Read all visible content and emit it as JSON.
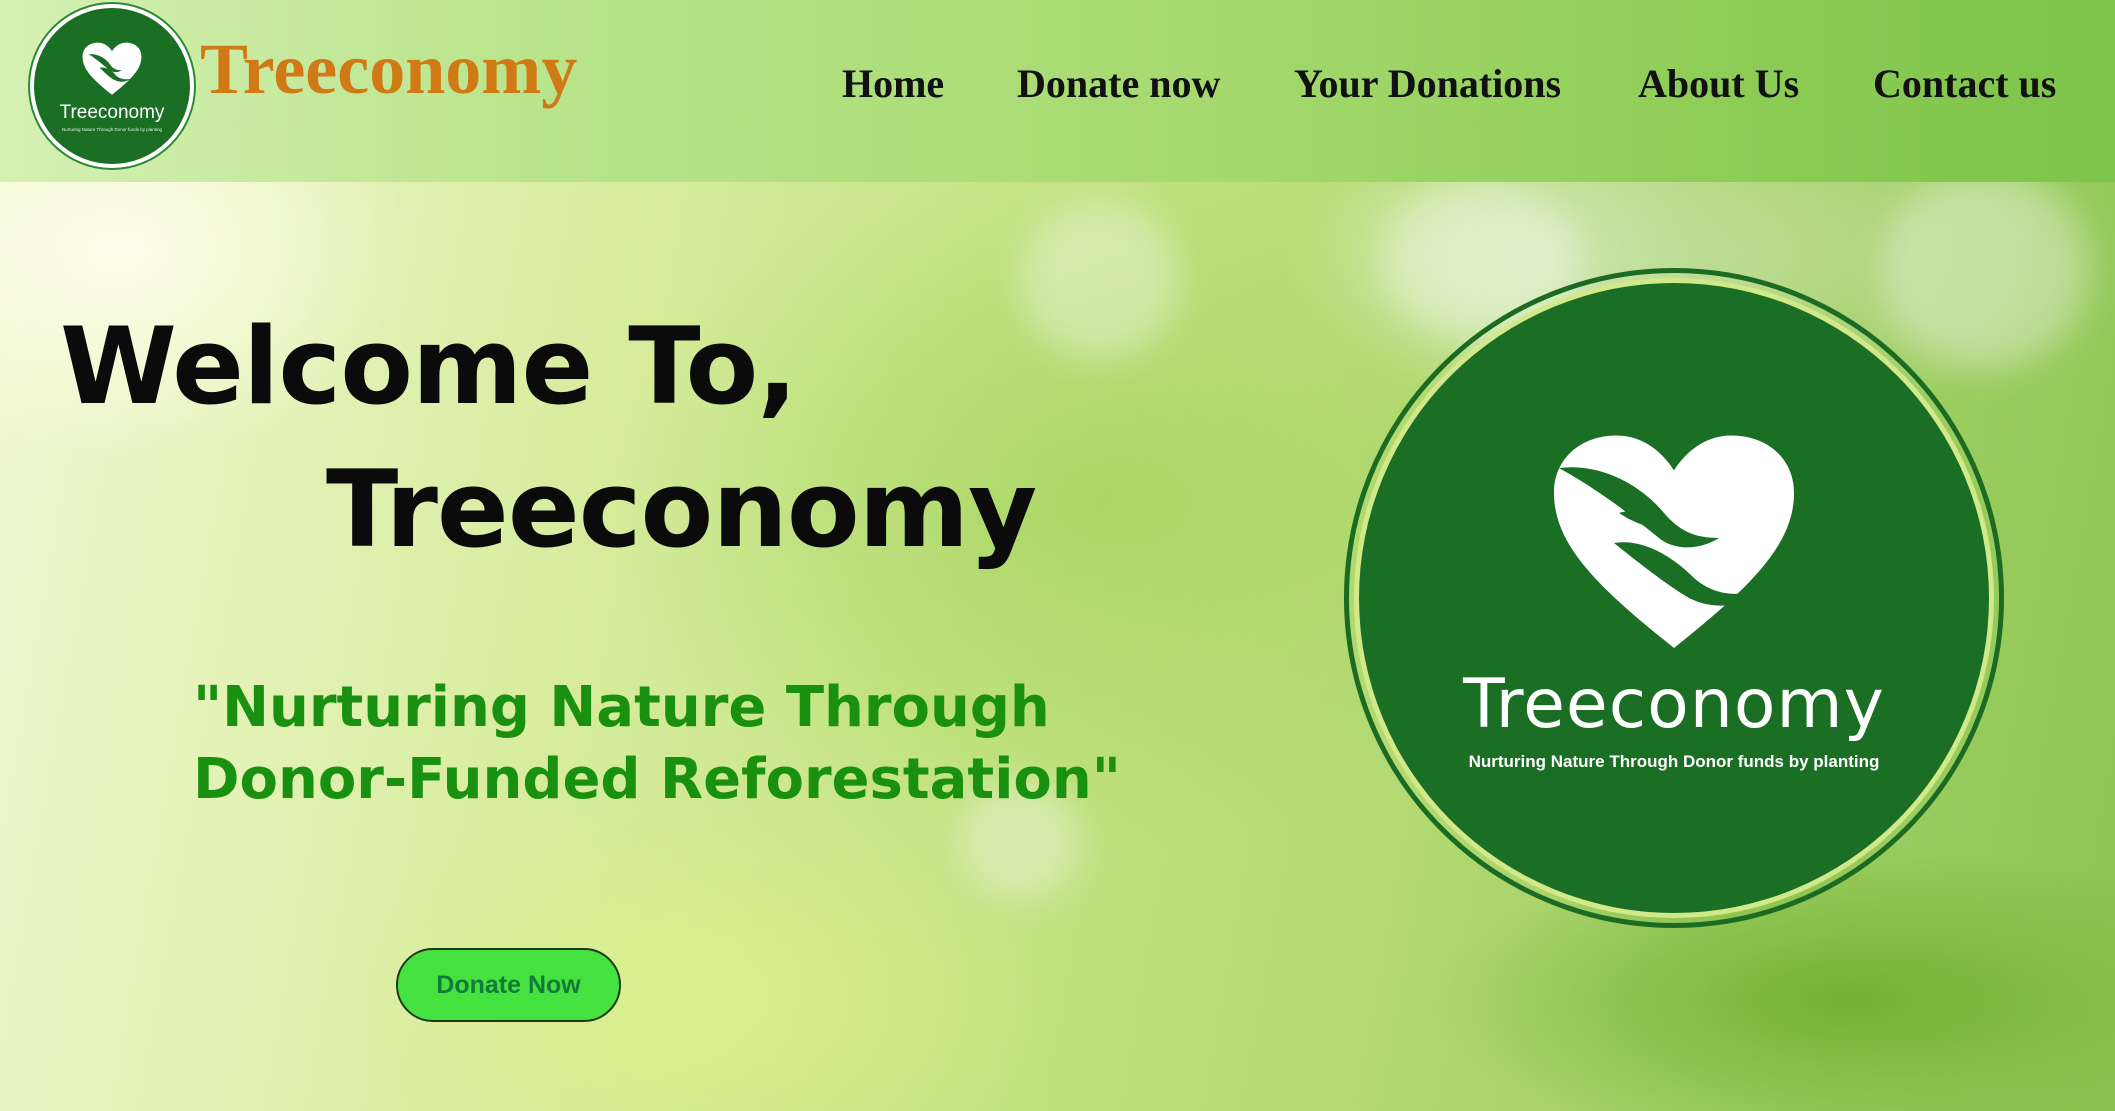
{
  "header": {
    "logo": {
      "icon": "heart-hands-icon",
      "name": "Treeconomy",
      "tagline": "Nurturing Nature Through Donor funds by planting"
    },
    "brand_title": "Treeconomy",
    "nav": [
      "Home",
      "Donate now",
      "Your Donations",
      "About Us",
      "Contact us"
    ]
  },
  "hero": {
    "welcome_line": "Welcome To,",
    "welcome_name": "Treeconomy",
    "tagline_line1": "\"Nurturing Nature Through",
    "tagline_line2": "Donor-Funded Reforestation\"",
    "cta": "Donate Now",
    "big_logo": {
      "icon": "heart-hands-icon",
      "name": "Treeconomy",
      "tagline": "Nurturing Nature Through Donor funds by planting"
    }
  },
  "colors": {
    "brand_orange": "#d07a16",
    "logo_green": "#1b6f25",
    "tagline_green": "#19900f",
    "button_green": "#45e23f"
  }
}
